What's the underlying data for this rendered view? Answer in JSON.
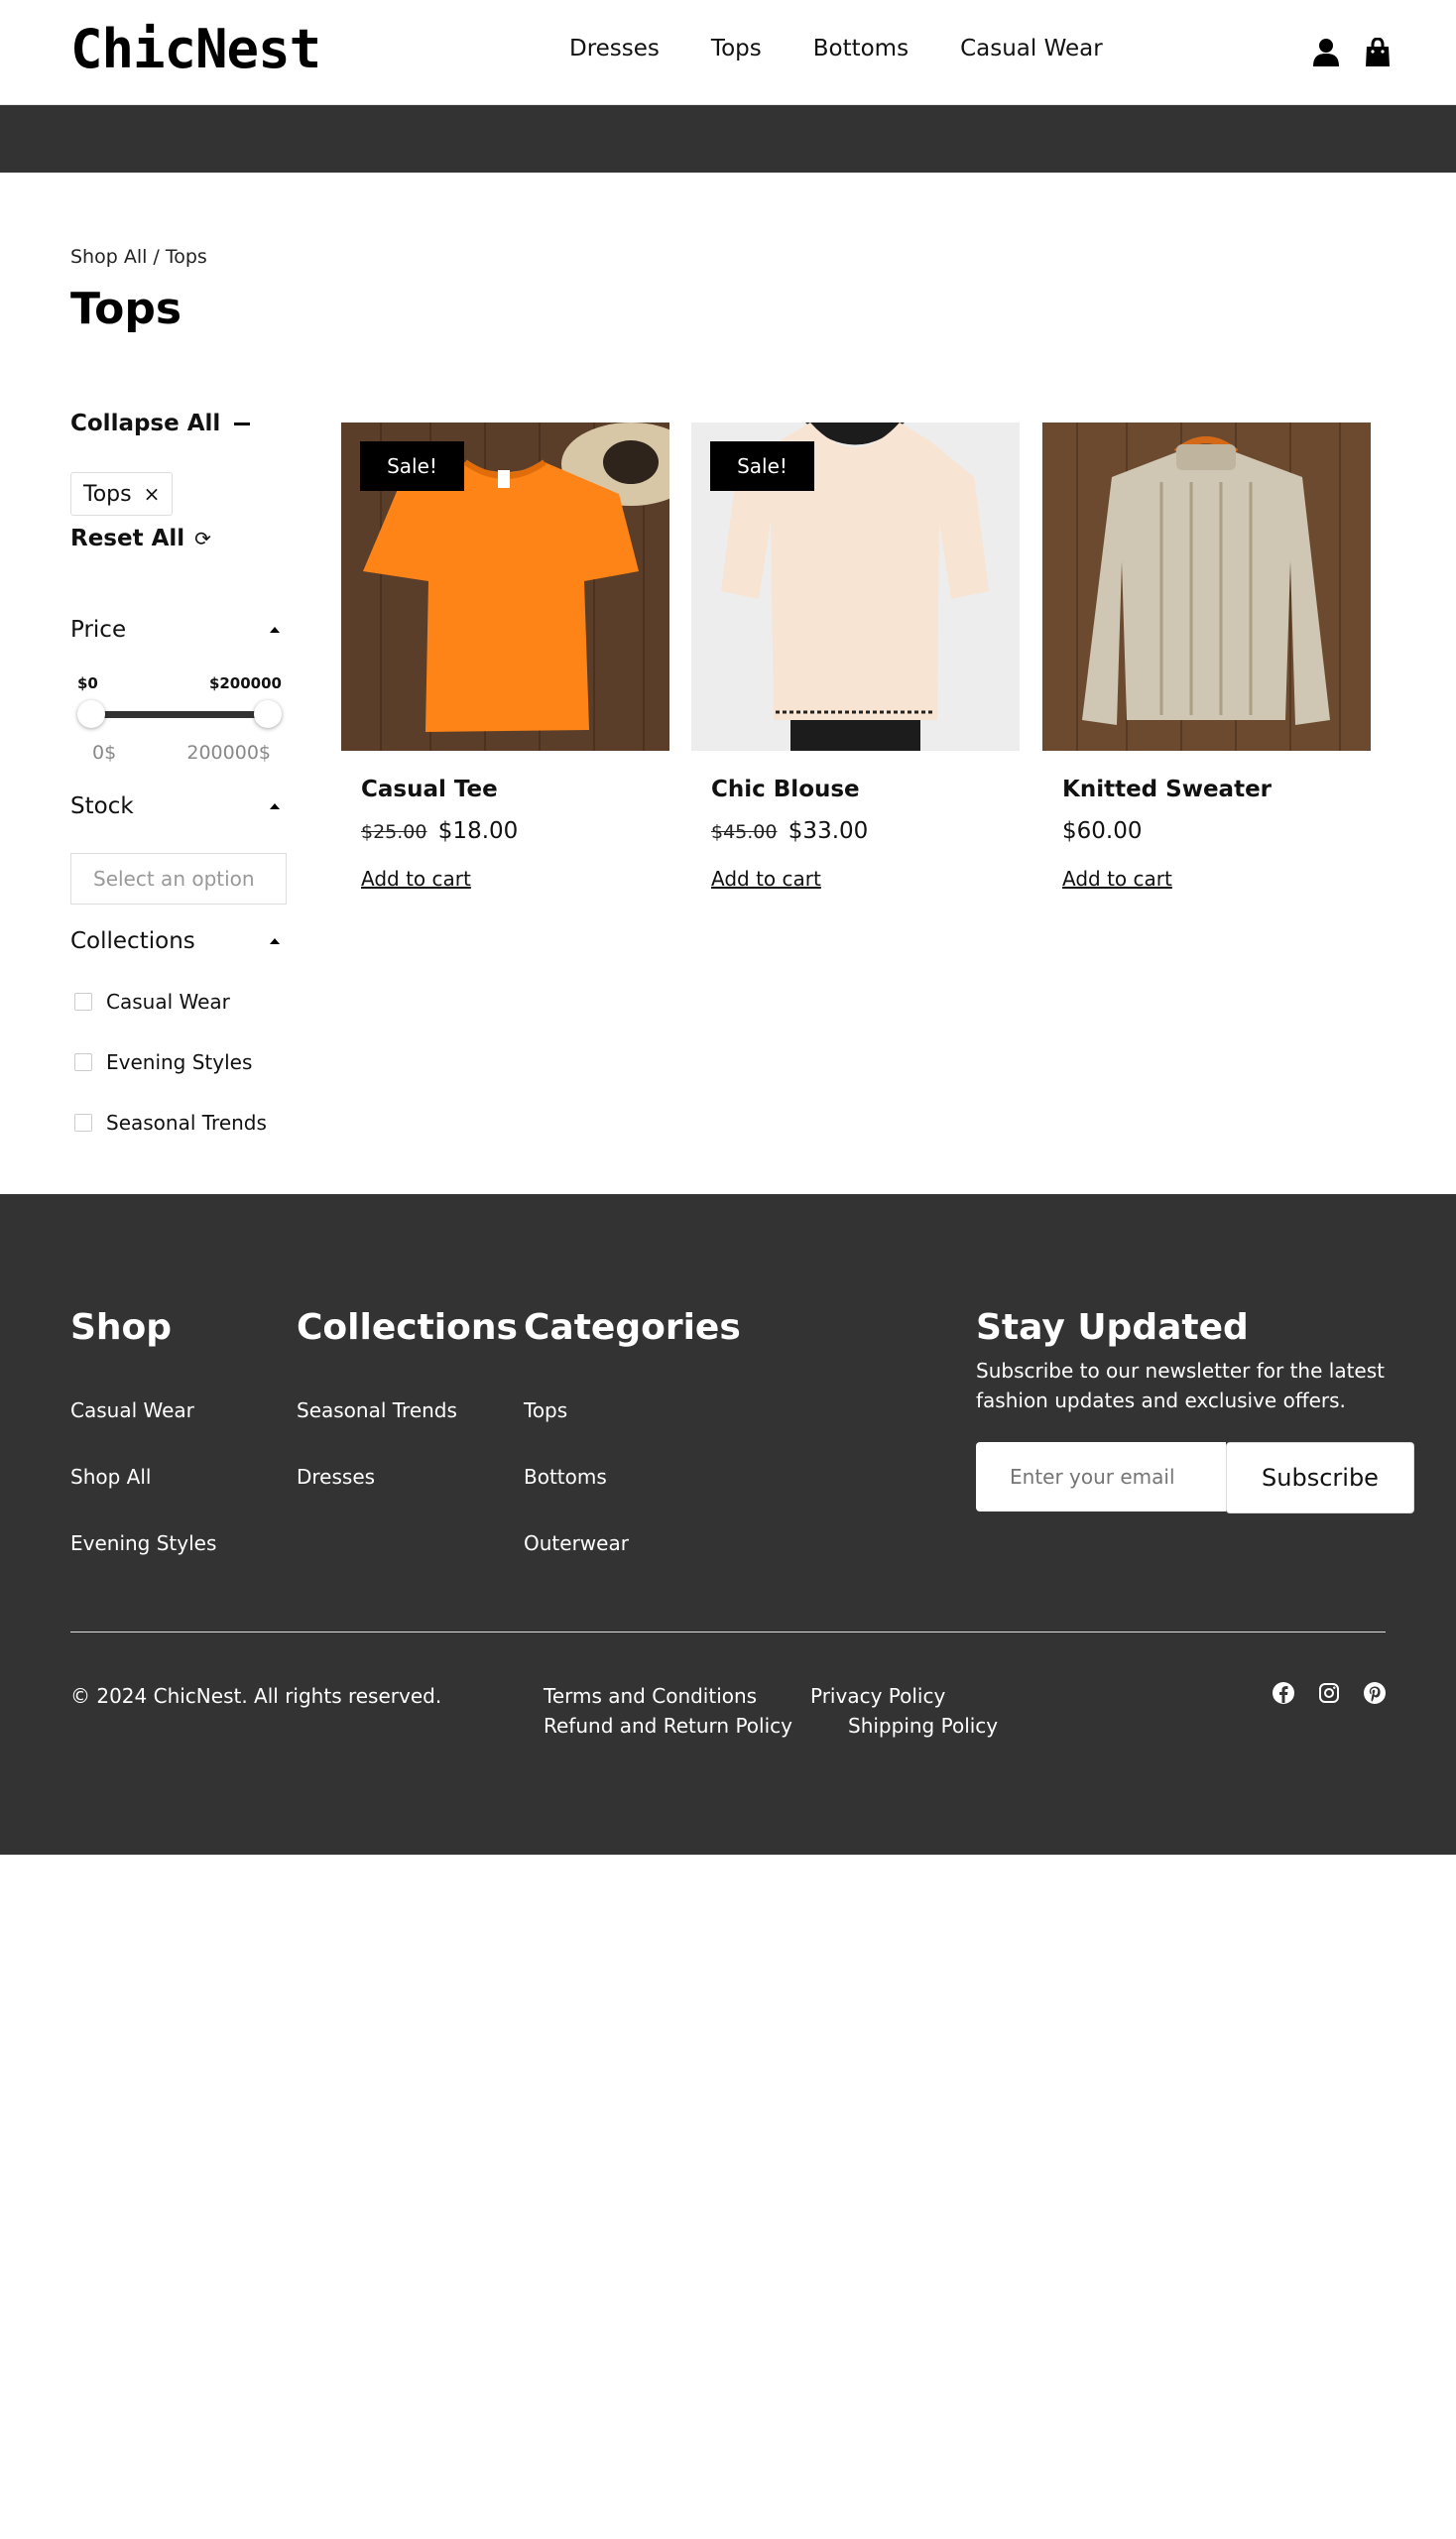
{
  "header": {
    "logo": "ChicNest",
    "nav": [
      "Dresses",
      "Tops",
      "Bottoms",
      "Casual Wear"
    ],
    "icons": [
      "user-icon",
      "shopping-bag-icon"
    ]
  },
  "breadcrumb": "Shop All / Tops",
  "page_title": "Tops",
  "sidebar": {
    "collapse_all": "Collapse All",
    "active_filter": "Tops",
    "active_filter_remove": "×",
    "reset_all": "Reset All",
    "reset_icon": "⟳",
    "price": {
      "label": "Price",
      "min_label": "$0",
      "max_label": "$200000",
      "min_value": "0$",
      "max_value": "200000$"
    },
    "stock": {
      "label": "Stock",
      "placeholder": "Select an option"
    },
    "collections": {
      "label": "Collections",
      "options": [
        "Casual Wear",
        "Evening Styles",
        "Seasonal Trends"
      ]
    }
  },
  "products": [
    {
      "name": "Casual Tee",
      "old_price": "$25.00",
      "price": "$18.00",
      "badge": "Sale!",
      "cta": "Add to cart"
    },
    {
      "name": "Chic Blouse",
      "old_price": "$45.00",
      "price": "$33.00",
      "badge": "Sale!",
      "cta": "Add to cart"
    },
    {
      "name": "Knitted Sweater",
      "old_price": "",
      "price": "$60.00",
      "badge": "",
      "cta": "Add to cart"
    }
  ],
  "footer": {
    "shop": {
      "title": "Shop",
      "links": [
        "Casual Wear",
        "Shop All",
        "Evening Styles"
      ]
    },
    "collections": {
      "title": "Collections",
      "links": [
        "Seasonal Trends",
        "Dresses"
      ]
    },
    "categories": {
      "title": "Categories",
      "links": [
        "Tops",
        "Bottoms",
        "Outerwear"
      ]
    },
    "newsletter": {
      "title": "Stay Updated",
      "text": "Subscribe to our newsletter for the latest fashion updates and exclusive offers.",
      "placeholder": "Enter your email",
      "button": "Subscribe"
    },
    "copyright": "© 2024 ChicNest. All rights reserved.",
    "legal": [
      "Terms and Conditions",
      "Privacy Policy",
      "Refund and Return Policy",
      "Shipping Policy"
    ],
    "socials": [
      "facebook-icon",
      "instagram-icon",
      "pinterest-icon"
    ]
  },
  "colors": {
    "dark": "#333333",
    "accent": "#000000",
    "tee": "#ff8417",
    "blouse": "#f8e4d2",
    "sweater": "#cfc6b3"
  }
}
